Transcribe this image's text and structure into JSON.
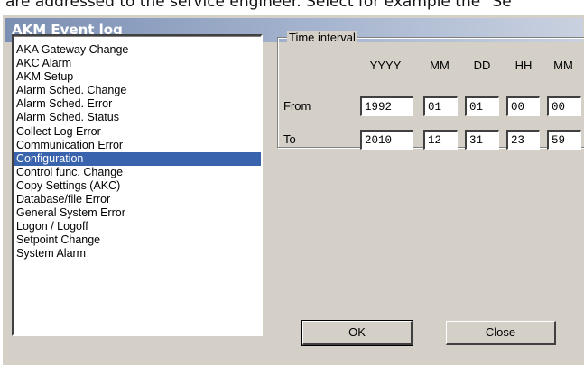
{
  "doc_text": "are addressed to the service engineer. Select for example the \"Se",
  "window": {
    "title": "AKM Event log"
  },
  "event_list": {
    "items": [
      "AKA Gateway Change",
      "AKC Alarm",
      "AKM Setup",
      "Alarm Sched. Change",
      "Alarm Sched. Error",
      "Alarm Sched. Status",
      "Collect Log Error",
      "Communication Error",
      "Configuration",
      "Control func. Change",
      "Copy Settings (AKC)",
      "Database/file Error",
      "General System Error",
      "Logon / Logoff",
      "Setpoint Change",
      "System Alarm"
    ],
    "selected": "Configuration"
  },
  "time_interval": {
    "legend": "Time interval",
    "headers": {
      "year": "YYYY",
      "month": "MM",
      "day": "DD",
      "hour": "HH",
      "minute": "MM"
    },
    "from": {
      "label": "From",
      "year": "1992",
      "month": "01",
      "day": "01",
      "hour": "00",
      "minute": "00"
    },
    "to": {
      "label": "To",
      "year": "2010",
      "month": "12",
      "day": "31",
      "hour": "23",
      "minute": "59"
    }
  },
  "buttons": {
    "ok": "OK",
    "close": "Close"
  }
}
